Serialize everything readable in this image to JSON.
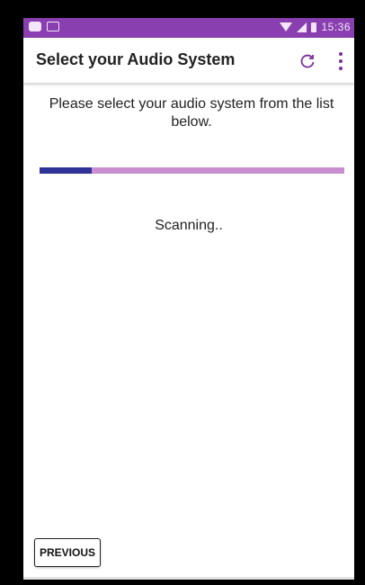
{
  "status_bar": {
    "time": "15:36",
    "icons": [
      "message-icon",
      "gmail-icon",
      "wifi-icon",
      "signal-icon",
      "battery-icon"
    ],
    "color": "#8a3fb0"
  },
  "app_bar": {
    "title": "Select your Audio System",
    "actions": [
      "refresh-icon",
      "more-options-icon"
    ],
    "accent": "#7b2f9e"
  },
  "main": {
    "instructions": "Please select your audio system from the list below.",
    "progress": {
      "fraction": 0.17,
      "fill_color": "#2f3397",
      "track_color": "#c98fd0"
    },
    "status_text": "Scanning.."
  },
  "footer": {
    "previous_label": "PREVIOUS"
  }
}
